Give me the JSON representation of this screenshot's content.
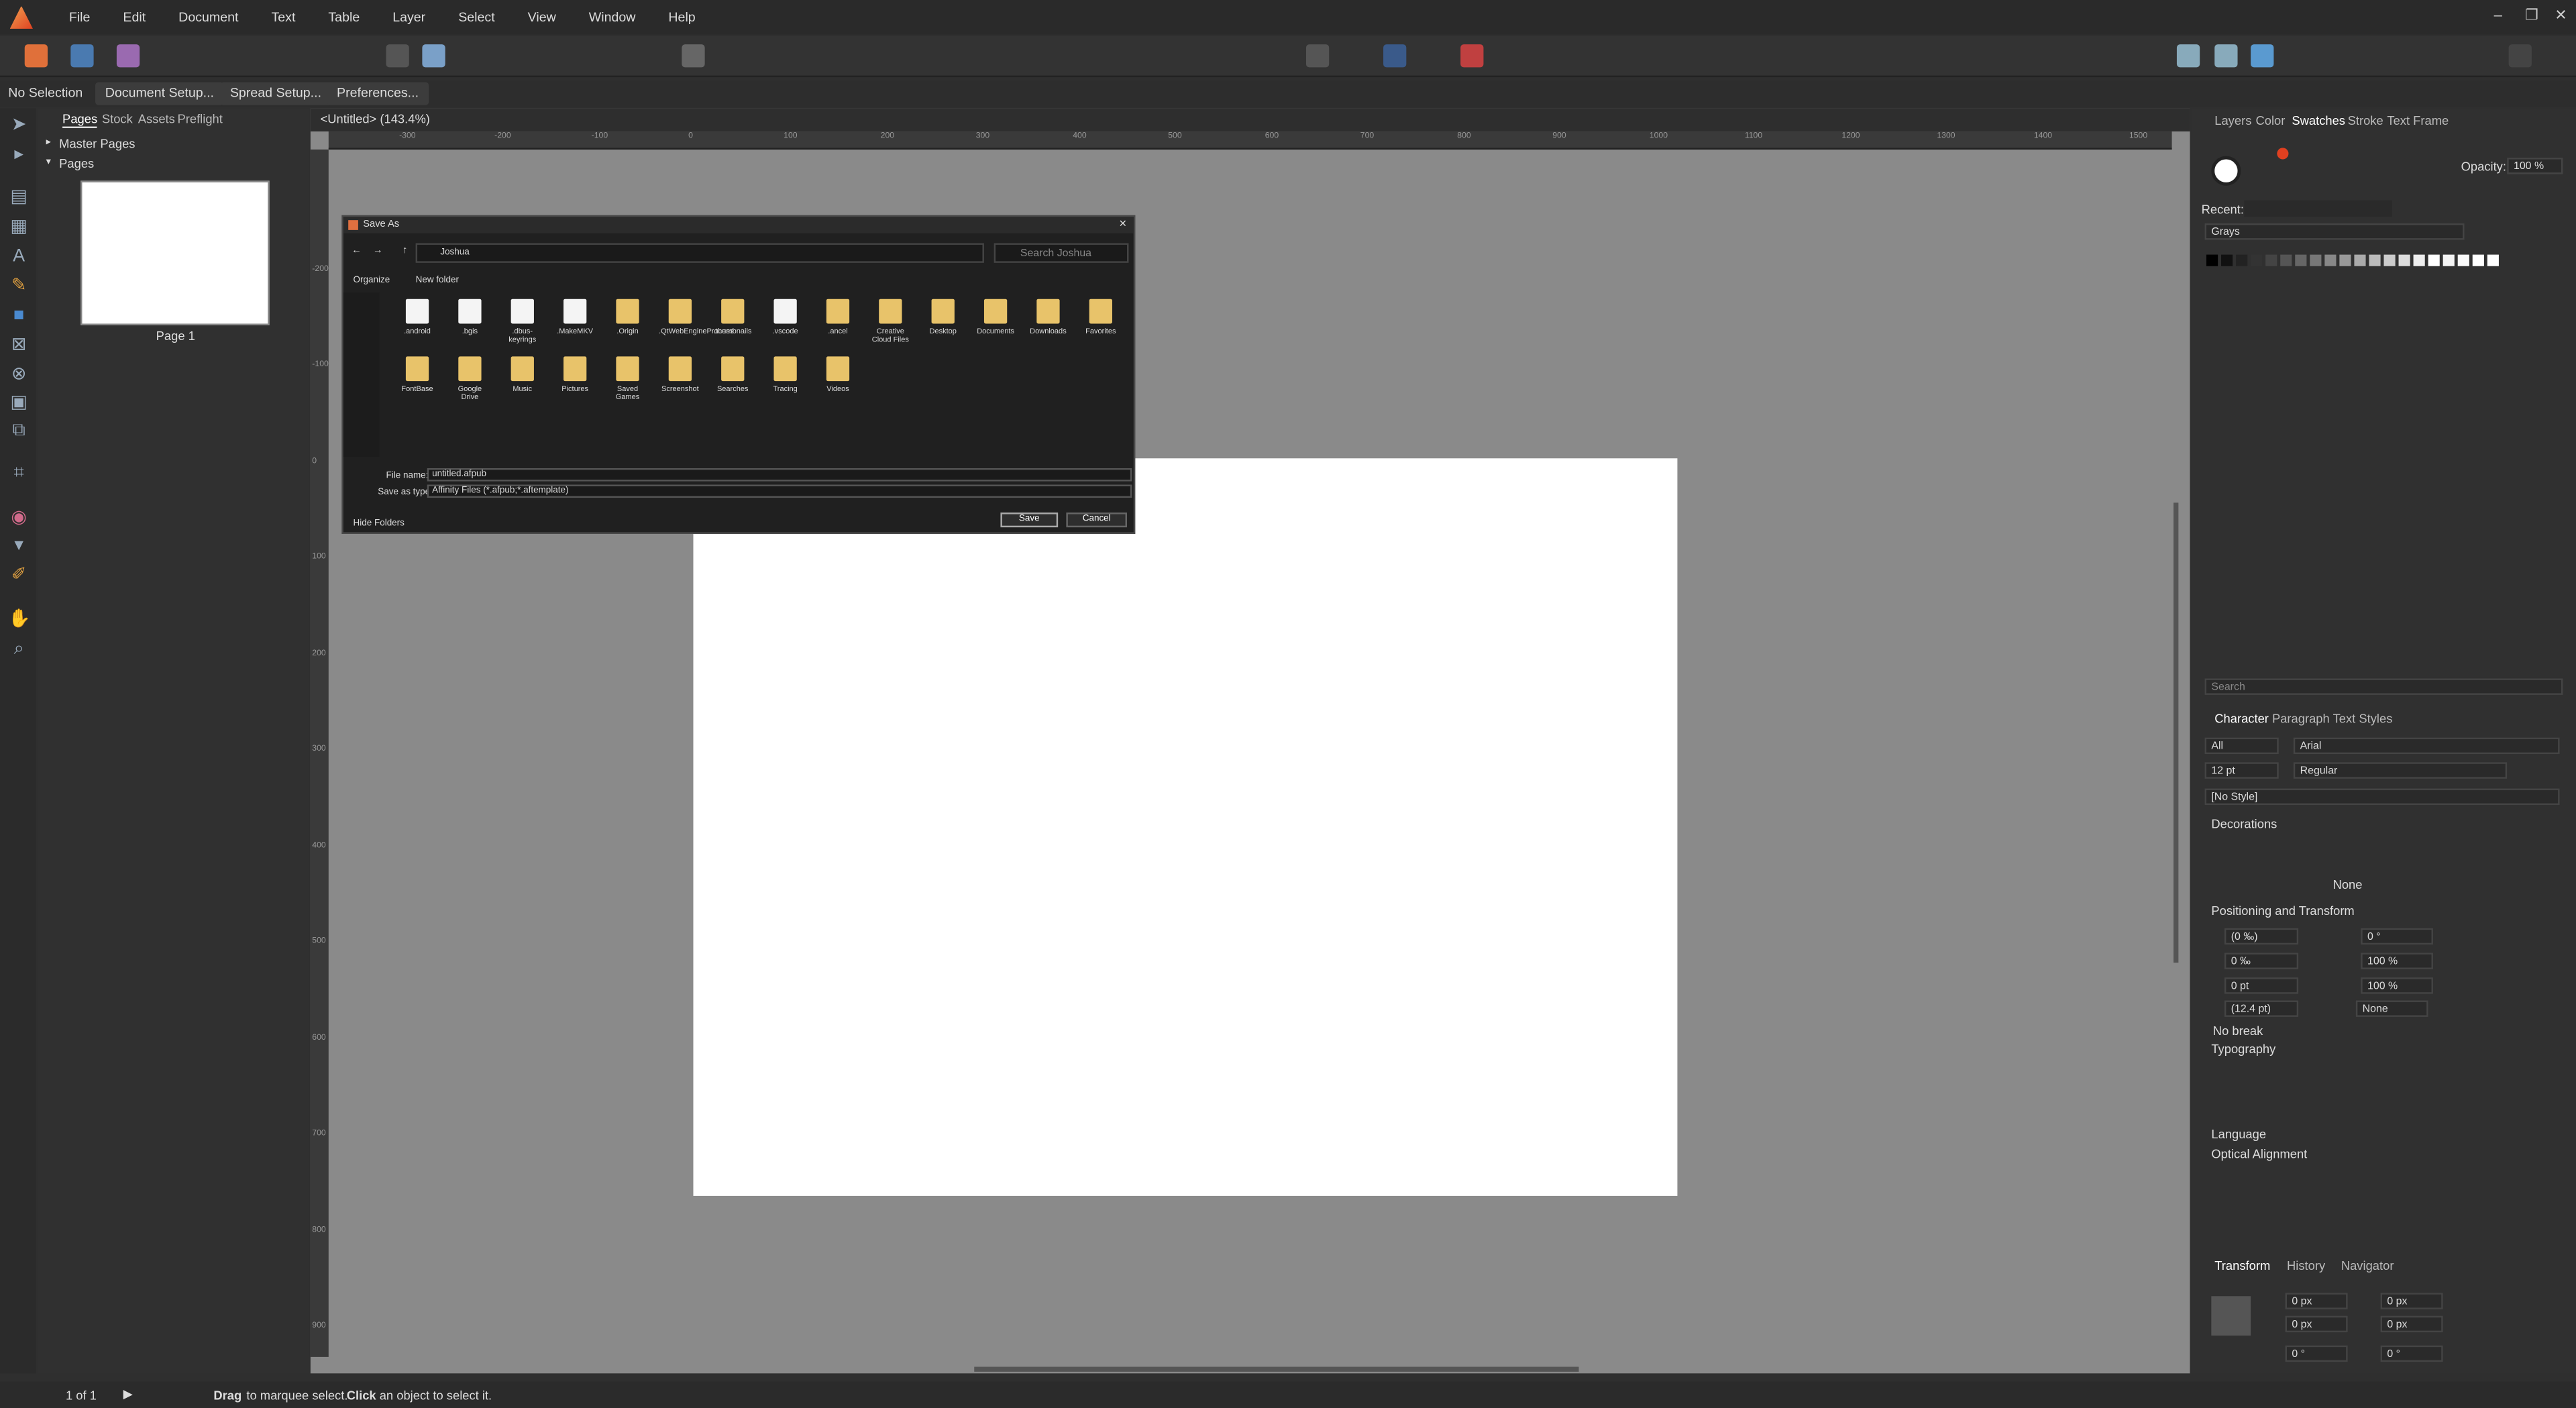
{
  "menubar": {
    "items": [
      "File",
      "Edit",
      "Document",
      "Text",
      "Table",
      "Layer",
      "Select",
      "View",
      "Window",
      "Help"
    ]
  },
  "context": {
    "selection": "No Selection",
    "buttons": [
      "Document Setup...",
      "Spread Setup...",
      "Preferences..."
    ]
  },
  "left_panel": {
    "tabs": [
      "Pages",
      "Stock",
      "Assets",
      "Preflight"
    ],
    "master_pages": "Master Pages",
    "pages": "Pages",
    "page_label": "Page 1"
  },
  "document": {
    "tab": "<Untitled> (143.4%)"
  },
  "ruler": {
    "h": [
      "-300",
      "-200",
      "-100",
      "0",
      "100",
      "200",
      "300",
      "400",
      "500",
      "600",
      "700",
      "800",
      "900",
      "1000",
      "1100",
      "1200",
      "1300",
      "1400",
      "1500"
    ],
    "v": [
      "-200",
      "-100",
      "0",
      "100",
      "200",
      "300",
      "400",
      "500",
      "600",
      "700",
      "800",
      "900"
    ]
  },
  "dialog": {
    "title": "Save As",
    "path": "Joshua",
    "search_placeholder": "Search Joshua",
    "organize": "Organize",
    "new_folder": "New folder",
    "folders": [
      ".android",
      ".bgis",
      ".dbus-keyrings",
      ".MakeMKV",
      ".Origin",
      ".QtWebEngineProcess",
      ".thumbnails",
      ".vscode",
      ".ancel",
      "Creative Cloud Files",
      "Desktop",
      "Documents",
      "Downloads",
      "Favorites",
      "FontBase",
      "Google Drive",
      "Music",
      "Pictures",
      "Saved Games",
      "Screenshot",
      "Searches",
      "Tracing",
      "Videos"
    ],
    "file_name_label": "File name:",
    "file_name": "untitled.afpub",
    "save_type_label": "Save as type:",
    "save_type": "Affinity Files (*.afpub;*.aftemplate)",
    "hide_folders": "Hide Folders",
    "save": "Save",
    "cancel": "Cancel"
  },
  "right_panel": {
    "tabs": [
      "Layers",
      "Color",
      "Swatches",
      "Stroke",
      "Text Frame"
    ],
    "opacity_label": "Opacity:",
    "opacity": "100 %",
    "recent_label": "Recent:",
    "palette": "Grays",
    "search_placeholder": "Search",
    "char_tabs": [
      "Character",
      "Paragraph",
      "Text Styles"
    ],
    "scope": "All",
    "font": "Arial",
    "size": "12 pt",
    "weight": "Regular",
    "style": "[No Style]",
    "decorations": "Decorations",
    "none": "None",
    "pos_transform": "Positioning and Transform",
    "kerning": "(0 ‰)",
    "tracking": "0 ‰",
    "baseline": "0 pt",
    "leading": "(12.4 pt)",
    "shear": "0 °",
    "vscale": "100 %",
    "hscale": "100 %",
    "script": "None",
    "no_break": "No break",
    "typography": "Typography",
    "language": "Language",
    "optical": "Optical Alignment",
    "bottom_tabs": [
      "Transform",
      "History",
      "Navigator"
    ],
    "t_x": "0 px",
    "t_y": "0 px",
    "t_w": "0 px",
    "t_h": "0 px",
    "t_r": "0 °",
    "t_s": "0 °"
  },
  "status": {
    "pages": "1 of 1",
    "hint_drag": "Drag",
    "hint_mid": "to marquee select.",
    "hint_click": "Click",
    "hint_end": "an object to select it."
  }
}
